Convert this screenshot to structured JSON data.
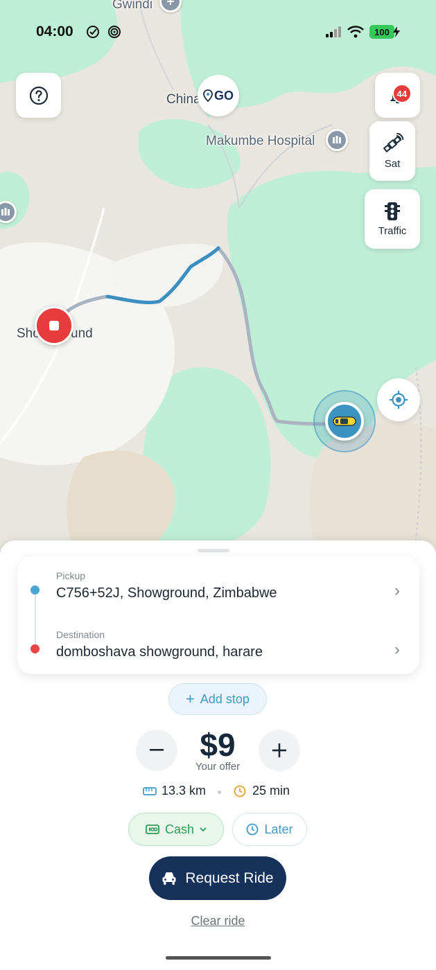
{
  "status_bar": {
    "time": "04:00",
    "battery": "100",
    "icons": [
      "check-circle-icon",
      "radar-icon",
      "signal-icon",
      "wifi-icon",
      "battery-icon"
    ]
  },
  "map": {
    "labels": {
      "gwindi": "Gwindi",
      "china": "China",
      "go": "GO",
      "hospital": "Makumbe Hospital",
      "showground_left": "Sho",
      "showground_right": "und"
    },
    "help_icon": "question-icon",
    "notifications_count": "44",
    "sat_label": "Sat",
    "traffic_label": "Traffic",
    "colors": {
      "land": "#e9e6df",
      "green": "#bfeed6",
      "urban": "#f5f5f3",
      "route_active": "#3b8fc0",
      "route_inactive": "#a9b4c0",
      "stop_marker": "#e83b3b",
      "driver_marker": "#3d93bf"
    }
  },
  "sheet": {
    "pickup": {
      "caption": "Pickup",
      "value": "C756+52J, Showground, Zimbabwe"
    },
    "destination": {
      "caption": "Destination",
      "value": "domboshava showground, harare"
    },
    "add_stop": "Add stop",
    "price": "$9",
    "offer_label": "Your offer",
    "distance": "13.3 km",
    "duration": "25 min",
    "payment": "Cash",
    "later": "Later",
    "request": "Request Ride",
    "clear": "Clear ride",
    "colors": {
      "pickup_dot": "#4aa3d4",
      "destination_dot": "#e84545",
      "primary": "#16325a",
      "accent_blue": "#3f9bc6",
      "accent_green": "#2f9a58"
    }
  }
}
